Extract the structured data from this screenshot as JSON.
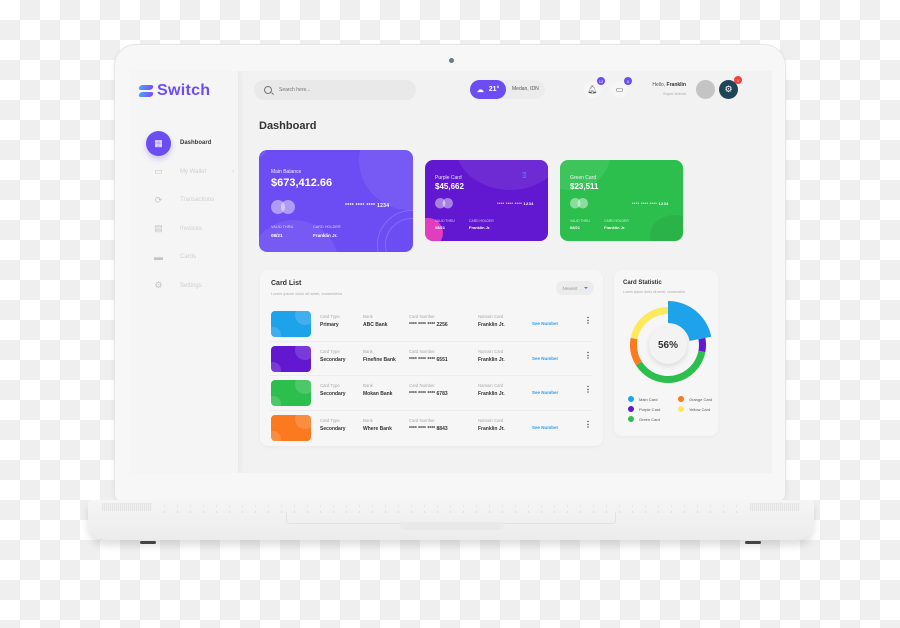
{
  "app": {
    "brand": "Switch"
  },
  "search": {
    "placeholder": "Search here..."
  },
  "weather": {
    "temp": "21°",
    "location": "Medan, IDN",
    "icon": "cloud-icon"
  },
  "notifications": {
    "count": "12",
    "icon": "bell-icon"
  },
  "messages": {
    "count": "5",
    "icon": "message-icon"
  },
  "user": {
    "greeting": "Hello,",
    "name": "Franklin",
    "role": "Super Admin"
  },
  "settings_badge": "1",
  "sidebar": {
    "items": [
      {
        "label": "Dashboard",
        "icon": "dashboard-icon",
        "glyph": "▦",
        "active": true
      },
      {
        "label": "My Wallet",
        "icon": "wallet-icon",
        "glyph": "▭",
        "chevron": "›"
      },
      {
        "label": "Transactions",
        "icon": "transactions-icon",
        "glyph": "⟳"
      },
      {
        "label": "Invoices",
        "icon": "invoices-icon",
        "glyph": "▤"
      },
      {
        "label": "Cards",
        "icon": "cards-icon",
        "glyph": "▬"
      },
      {
        "label": "Settings",
        "icon": "settings-icon",
        "glyph": "⚙"
      }
    ]
  },
  "page_title": "Dashboard",
  "cards": {
    "main": {
      "label": "Main Balance",
      "amount": "$673,412.66",
      "number": "**** **** **** 1234",
      "valid_label": "VALID THRU",
      "valid": "08/21",
      "holder_label": "CARD HOLDER",
      "holder": "Franklin Jr.",
      "color": "#6c4cf3"
    },
    "purple": {
      "label": "Purple Card",
      "amount": "$45,662",
      "number": "**** **** **** 1234",
      "valid_label": "VALID THRU",
      "valid": "08/21",
      "holder_label": "CARD HOLDER",
      "holder": "Franklin Jr.",
      "color": "#6218d0"
    },
    "green": {
      "label": "Green Card",
      "amount": "$23,511",
      "number": "**** **** **** 1234",
      "valid_label": "VALID THRU",
      "valid": "08/21",
      "holder_label": "CARD HOLDER",
      "holder": "Franklin Jr.",
      "color": "#2dbf4e"
    }
  },
  "card_list": {
    "title": "Card List",
    "subtitle": "Lorem ipsum dolor sit amet, consectetur",
    "sort": "Newest",
    "headers": {
      "type": "Card Type",
      "bank": "Bank",
      "number": "Card Number",
      "name": "Namain Card"
    },
    "action_label": "See Number",
    "rows": [
      {
        "color": "#1ea2ea",
        "type": "Primary",
        "bank": "ABC Bank",
        "number": "**** **** **** 2256",
        "name": "Franklin Jr."
      },
      {
        "color": "#6218d0",
        "type": "Secondary",
        "bank": "Finefine Bank",
        "number": "**** **** **** 6551",
        "name": "Franklin Jr."
      },
      {
        "color": "#2dbf4e",
        "type": "Secondary",
        "bank": "Mokan Bank",
        "number": "**** **** **** 6783",
        "name": "Franklin Jr."
      },
      {
        "color": "#fb7a1f",
        "type": "Secondary",
        "bank": "Where Bank",
        "number": "**** **** **** 8843",
        "name": "Franklin Jr."
      }
    ]
  },
  "card_statistic": {
    "title": "Card Statistic",
    "subtitle": "Lorem ipsum dolor sit amet, consectetur",
    "center_value": "56%",
    "legend": [
      {
        "label": "Main Card",
        "color": "#1ea2ea"
      },
      {
        "label": "Orange Card",
        "color": "#fb7a1f"
      },
      {
        "label": "Purple Card",
        "color": "#6218d0"
      },
      {
        "label": "Yellow Card",
        "color": "#fde95a"
      },
      {
        "label": "Green Card",
        "color": "#2dbf4e"
      }
    ],
    "segments": [
      {
        "name": "Main Card",
        "color": "#1ea2ea",
        "start": 0,
        "end": 0.22,
        "expanded": true
      },
      {
        "name": "Purple Card",
        "color": "#6218d0",
        "start": 0.22,
        "end": 0.28
      },
      {
        "name": "Green Card",
        "color": "#2dbf4e",
        "start": 0.28,
        "end": 0.66
      },
      {
        "name": "Orange Card",
        "color": "#fb7a1f",
        "start": 0.66,
        "end": 0.78
      },
      {
        "name": "Yellow Card",
        "color": "#fde95a",
        "start": 0.78,
        "end": 1.0
      }
    ]
  }
}
